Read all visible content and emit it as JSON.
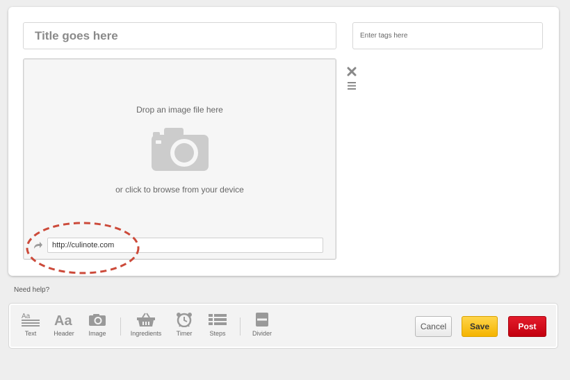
{
  "editor": {
    "title_placeholder": "Title goes here",
    "tags_placeholder": "Enter tags here"
  },
  "image_block": {
    "drop_text": "Drop an image file here",
    "browse_text": "or click to browse from your device",
    "url_value": "http://culinote.com",
    "icons": {
      "camera": "camera-icon",
      "url": "arrow-forward-icon",
      "remove": "close-icon",
      "reorder": "drag-handle-icon"
    }
  },
  "help": {
    "label": "Need help?"
  },
  "toolbar": {
    "tools": [
      {
        "label": "Text",
        "icon": "text-icon"
      },
      {
        "label": "Header",
        "icon": "header-icon"
      },
      {
        "label": "Image",
        "icon": "camera-icon"
      },
      {
        "label": "Ingredients",
        "icon": "basket-icon"
      },
      {
        "label": "Timer",
        "icon": "alarm-clock-icon"
      },
      {
        "label": "Steps",
        "icon": "list-icon"
      },
      {
        "label": "Divider",
        "icon": "divider-icon"
      }
    ],
    "cancel_label": "Cancel",
    "save_label": "Save",
    "post_label": "Post"
  },
  "colors": {
    "post": "#d10a1b",
    "save": "#f9c21f",
    "annotation": "#cc4a3a"
  }
}
